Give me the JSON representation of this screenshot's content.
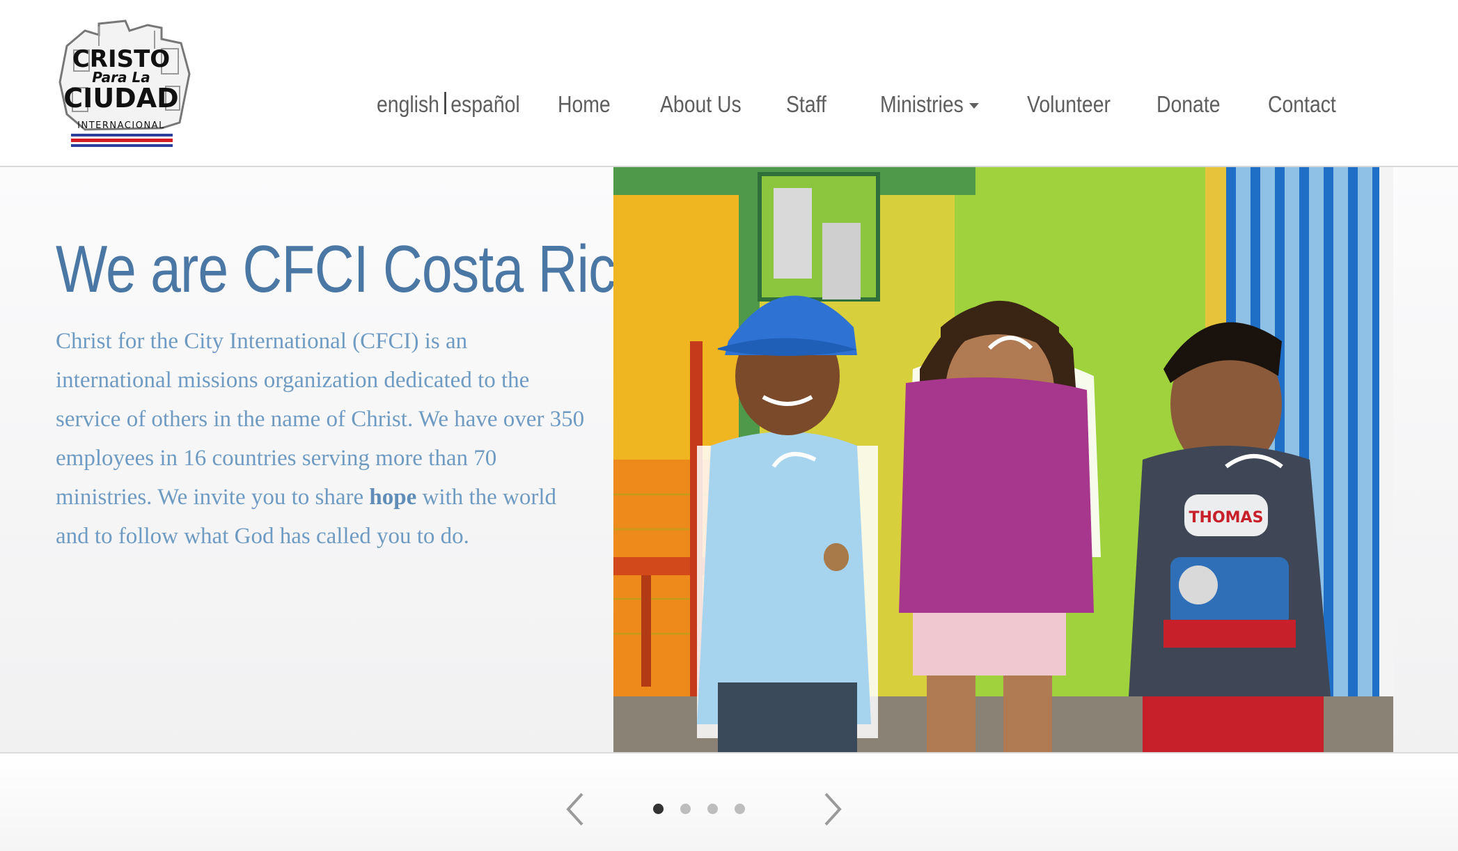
{
  "header": {
    "logo_alt": "Cristo Para La Ciudad Internacional",
    "logo_lines": [
      "CRISTO",
      "Para La",
      "CIUDAD",
      "INTERNACIONAL"
    ],
    "language": {
      "english": "english",
      "spanish": "español"
    },
    "nav": {
      "home": "Home",
      "about": "About Us",
      "staff": "Staff",
      "ministries": "Ministries",
      "volunteer": "Volunteer",
      "donate": "Donate",
      "contact": "Contact"
    }
  },
  "hero": {
    "title": "We are CFCI Costa Rica",
    "text_before": "Christ for the City International (CFCI) is an international missions organization dedicated to the service of others in the name of Christ. We have over 350 employees in 16 countries serving more than 70 ministries. We invite you to share ",
    "text_bold": "hope",
    "text_after": " with the world and to follow what God has called you to do.",
    "photo": {
      "description_icon": "children-photo",
      "shirt_text": "THOMAS"
    }
  },
  "carousel": {
    "prev_icon": "chevron-left-icon",
    "next_icon": "chevron-right-icon",
    "slides": 4,
    "active_slide": 1
  },
  "colors": {
    "accent": "#4a77a4",
    "body_text": "#6f9bc3",
    "nav_text": "#5e5e5e"
  }
}
